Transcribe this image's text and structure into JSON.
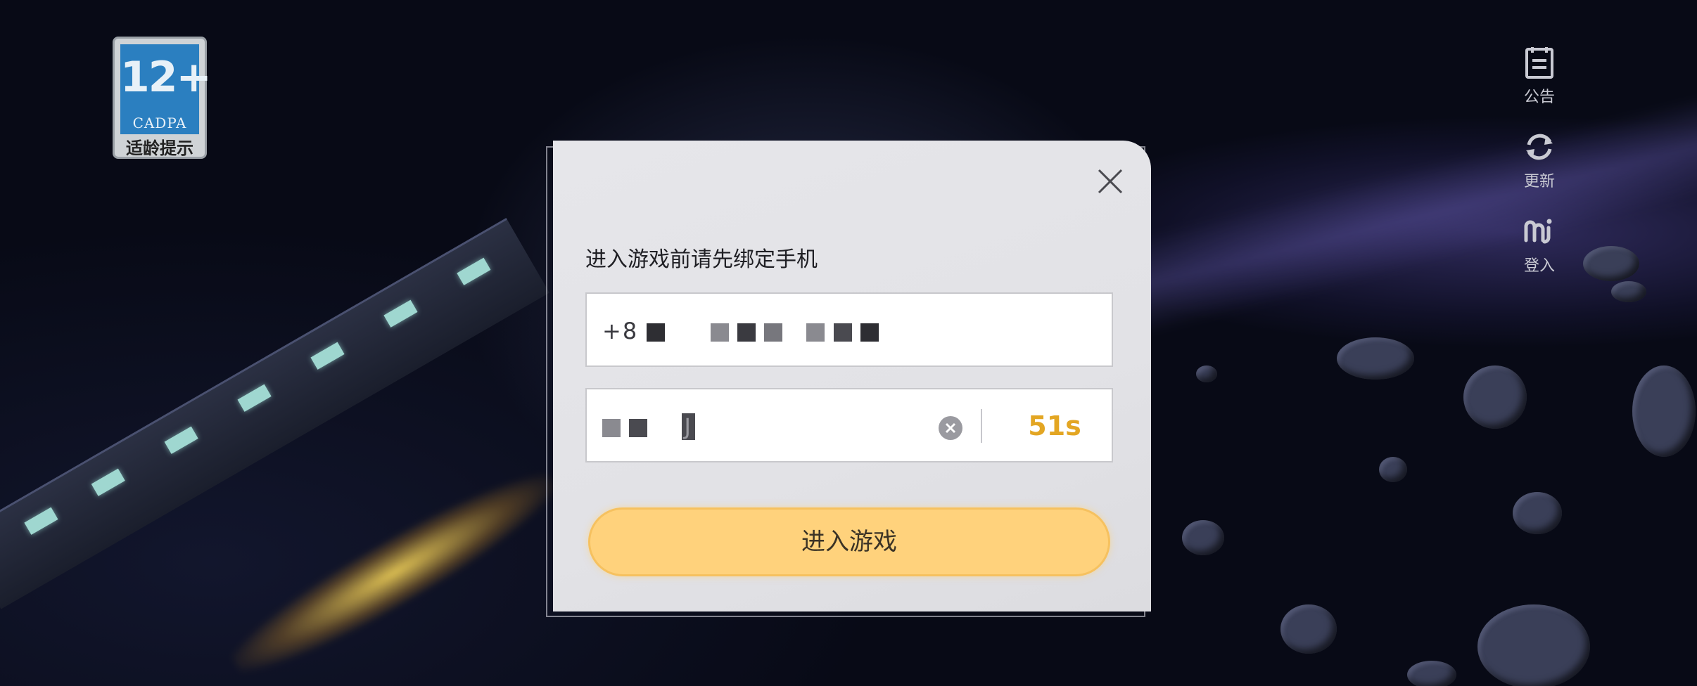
{
  "age_rating": {
    "age": "12+",
    "org": "CADPA",
    "tip": "适龄提示"
  },
  "side_menu": {
    "announcement": "公告",
    "update": "更新",
    "login": "登入"
  },
  "dialog": {
    "prompt": "进入游戏前请先绑定手机",
    "phone_value": "+8",
    "code_value": "J",
    "countdown": "51s",
    "enter_button": "进入游戏"
  },
  "colors": {
    "accent": "#ffd27c",
    "countdown": "#e3a623"
  }
}
